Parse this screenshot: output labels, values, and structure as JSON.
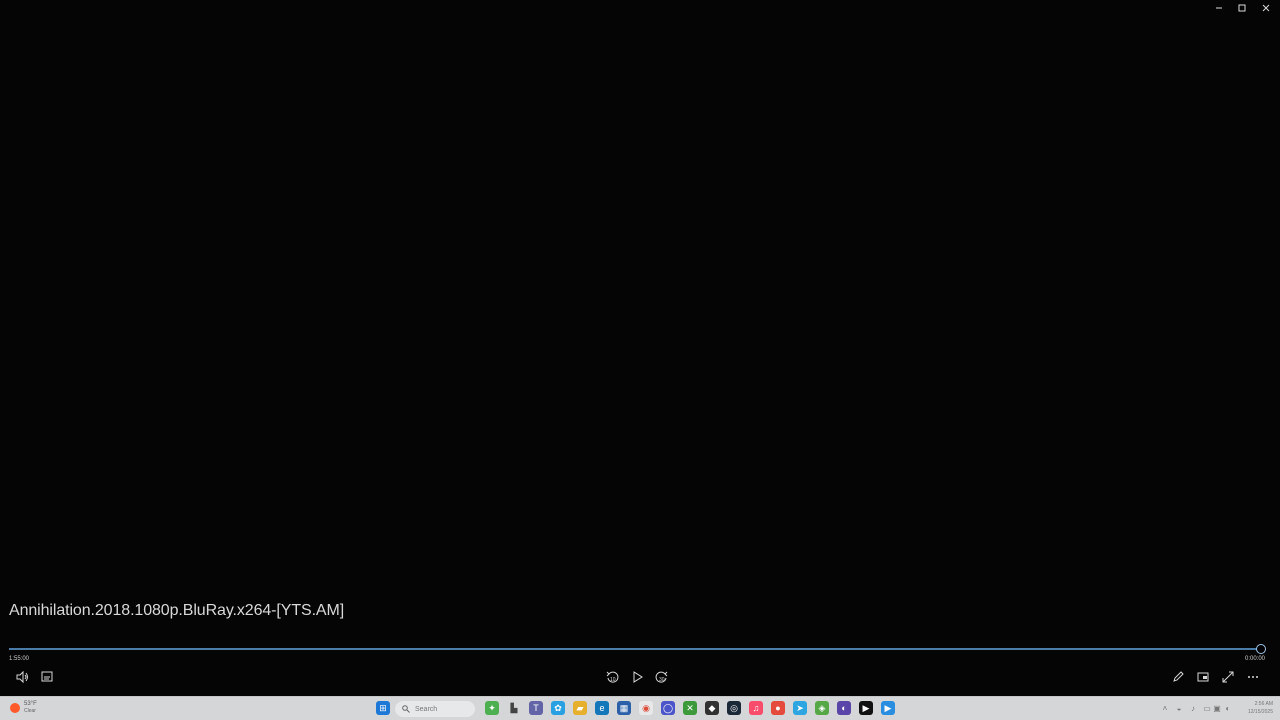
{
  "video": {
    "title": "Annihilation.2018.1080p.BluRay.x264-[YTS.AM]",
    "time_remaining_left": "1:55:00",
    "time_right": "0:00:00"
  },
  "window_controls": {
    "minimize": "minimize-icon",
    "restore": "restore-icon",
    "close": "close-icon"
  },
  "controls": {
    "left": [
      "volume-icon",
      "subtitles-icon"
    ],
    "center": [
      "skip-back-10-icon",
      "play-icon",
      "skip-forward-30-icon"
    ],
    "right": [
      "edit-icon",
      "miniplayer-icon",
      "fullscreen-icon",
      "more-icon"
    ]
  },
  "taskbar": {
    "weather_temp": "53°F",
    "weather_condition": "Clear",
    "search_placeholder": "Search",
    "clock_time": "2:56 AM",
    "clock_date": "12/15/2025",
    "icons": [
      "windows-start-icon",
      "search-icon",
      "xbox-game-icon",
      "file-explorer-icon",
      "teams-icon",
      "copilot-icon",
      "folder-icon",
      "edge-icon",
      "calculator-icon",
      "chrome-icon",
      "chat-icon",
      "xbox-icon",
      "game-launcher-icon",
      "steam-icon",
      "apple-music-icon",
      "record-icon",
      "telegram-icon",
      "browser-icon",
      "circle-app-icon",
      "apple-tv-icon",
      "media-player-icon"
    ],
    "tray_icons": [
      "chevron-up-icon",
      "vpn-icon",
      "microphone-icon",
      "display-icon",
      "network-icon",
      "speaker-icon"
    ]
  }
}
